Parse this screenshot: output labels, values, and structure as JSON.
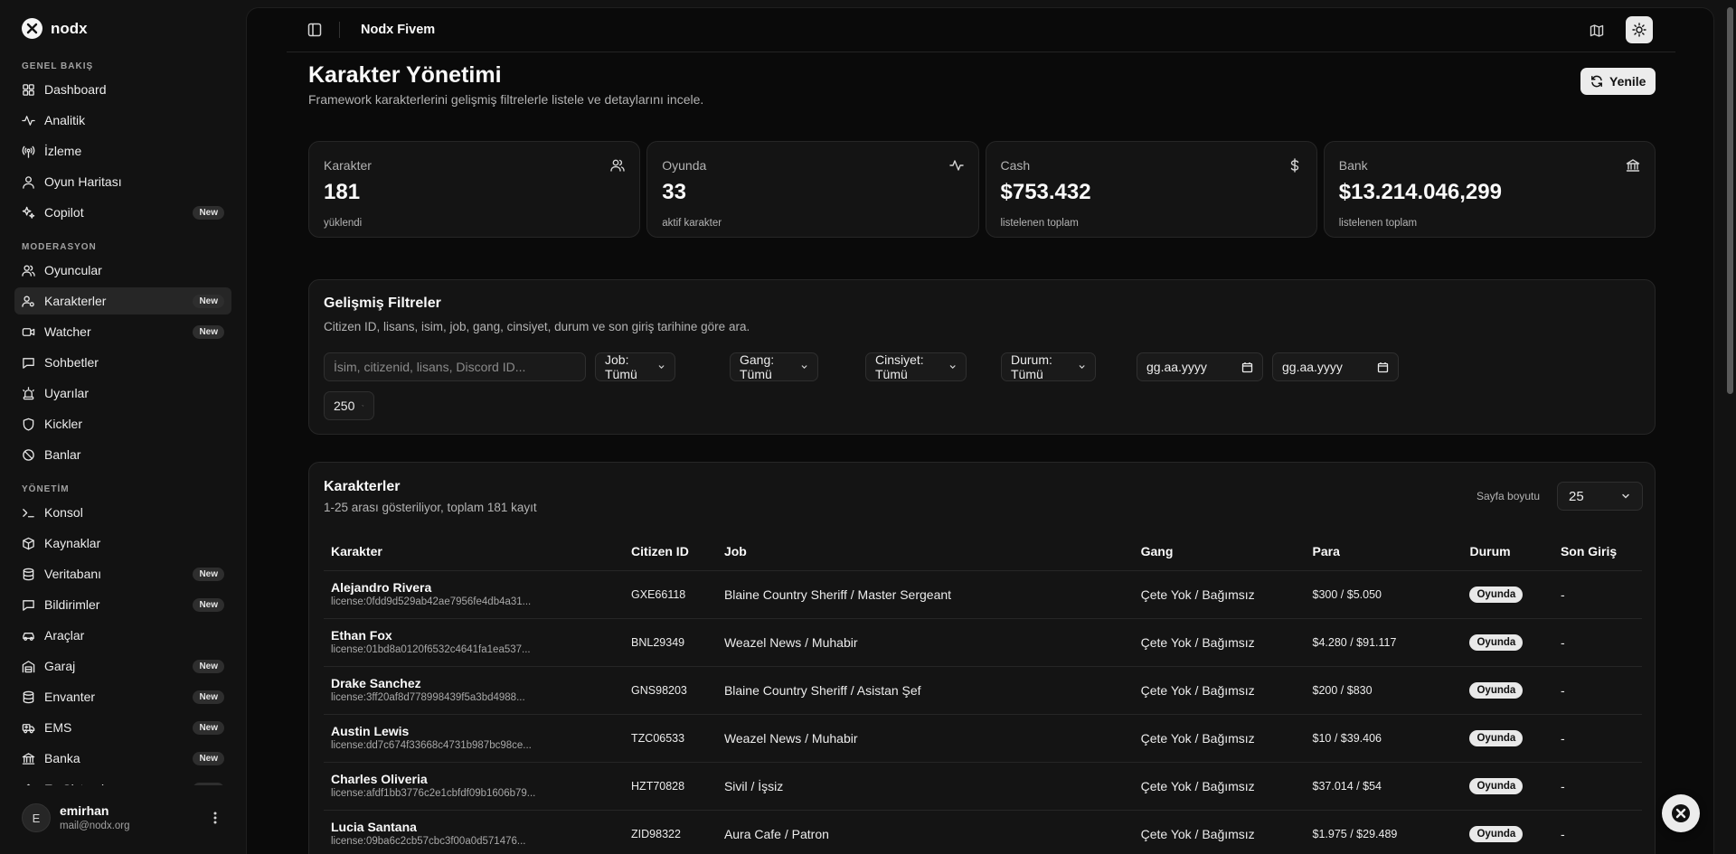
{
  "brand": {
    "name": "nodx"
  },
  "sidebar": {
    "sections": [
      {
        "title": "GENEL BAKIŞ",
        "items": [
          {
            "label": "Dashboard",
            "icon": "dashboard-icon"
          },
          {
            "label": "Analitik",
            "icon": "activity-icon"
          },
          {
            "label": "İzleme",
            "icon": "radio-tower-icon"
          },
          {
            "label": "Oyun Haritası",
            "icon": "user-map-icon"
          },
          {
            "label": "Copilot",
            "icon": "sparkles-icon",
            "badge": "New"
          }
        ]
      },
      {
        "title": "MODERASYON",
        "items": [
          {
            "label": "Oyuncular",
            "icon": "users-icon"
          },
          {
            "label": "Karakterler",
            "icon": "user-cog-icon",
            "badge": "New",
            "active": true
          },
          {
            "label": "Watcher",
            "icon": "video-icon",
            "badge": "New"
          },
          {
            "label": "Sohbetler",
            "icon": "message-icon"
          },
          {
            "label": "Uyarılar",
            "icon": "siren-icon"
          },
          {
            "label": "Kickler",
            "icon": "shield-icon"
          },
          {
            "label": "Banlar",
            "icon": "ban-icon"
          }
        ]
      },
      {
        "title": "YÖNETİM",
        "items": [
          {
            "label": "Konsol",
            "icon": "terminal-icon"
          },
          {
            "label": "Kaynaklar",
            "icon": "package-icon"
          },
          {
            "label": "Veritabanı",
            "icon": "database-icon",
            "badge": "New"
          },
          {
            "label": "Bildirimler",
            "icon": "message-icon",
            "badge": "New"
          },
          {
            "label": "Araçlar",
            "icon": "car-icon"
          },
          {
            "label": "Garaj",
            "icon": "warehouse-icon",
            "badge": "New"
          },
          {
            "label": "Envanter",
            "icon": "database-icon",
            "badge": "New"
          },
          {
            "label": "EMS",
            "icon": "ambulance-icon",
            "badge": "New"
          },
          {
            "label": "Banka",
            "icon": "bank-icon",
            "badge": "New"
          },
          {
            "label": "Ev Sistemi",
            "icon": "home-icon",
            "badge": "New"
          }
        ]
      }
    ]
  },
  "user": {
    "initial": "E",
    "name": "emirhan",
    "email": "mail@nodx.org"
  },
  "topbar": {
    "title": "Nodx Fivem"
  },
  "page": {
    "title": "Karakter Yönetimi",
    "subtitle": "Framework karakterlerini gelişmiş filtrelerle listele ve detaylarını incele.",
    "refresh_label": "Yenile"
  },
  "stats": [
    {
      "label": "Karakter",
      "value": "181",
      "foot": "yüklendi",
      "icon": "users-icon"
    },
    {
      "label": "Oyunda",
      "value": "33",
      "foot": "aktif karakter",
      "icon": "activity-icon"
    },
    {
      "label": "Cash",
      "value": "$753.432",
      "foot": "listelenen toplam",
      "icon": "dollar-icon"
    },
    {
      "label": "Bank",
      "value": "$13.214.046,299",
      "foot": "listelenen toplam",
      "icon": "bank-icon"
    }
  ],
  "filters": {
    "title": "Gelişmiş Filtreler",
    "subtitle": "Citizen ID, lisans, isim, job, gang, cinsiyet, durum ve son giriş tarihine göre ara.",
    "search_placeholder": "İsim, citizenid, lisans, Discord ID...",
    "job": "Job: Tümü",
    "gang": "Gang: Tümü",
    "gender": "Cinsiyet: Tümü",
    "status": "Durum: Tümü",
    "date_from": "gg.aa.yyyy",
    "date_to": "gg.aa.yyyy",
    "limit": "250"
  },
  "table": {
    "title": "Karakterler",
    "subtitle": "1-25 arası gösteriliyor, toplam 181 kayıt",
    "page_size_label": "Sayfa boyutu",
    "page_size": "25",
    "columns": [
      "Karakter",
      "Citizen ID",
      "Job",
      "Gang",
      "Para",
      "Durum",
      "Son Giriş"
    ],
    "rows": [
      {
        "name": "Alejandro Rivera",
        "license": "license:0fdd9d529ab42ae7956fe4db4a31...",
        "cid": "GXE66118",
        "job": "Blaine Country Sheriff / Master Sergeant",
        "gang": "Çete Yok / Bağımsız",
        "para": "$300 / $5.050",
        "status": "Oyunda",
        "last": "-"
      },
      {
        "name": "Ethan Fox",
        "license": "license:01bd8a0120f6532c4641fa1ea537...",
        "cid": "BNL29349",
        "job": "Weazel News / Muhabir",
        "gang": "Çete Yok / Bağımsız",
        "para": "$4.280 / $91.117",
        "status": "Oyunda",
        "last": "-"
      },
      {
        "name": "Drake Sanchez",
        "license": "license:3ff20af8d778998439f5a3bd4988...",
        "cid": "GNS98203",
        "job": "Blaine Country Sheriff / Asistan Şef",
        "gang": "Çete Yok / Bağımsız",
        "para": "$200 / $830",
        "status": "Oyunda",
        "last": "-"
      },
      {
        "name": "Austin Lewis",
        "license": "license:dd7c674f33668c4731b987bc98ce...",
        "cid": "TZC06533",
        "job": "Weazel News / Muhabir",
        "gang": "Çete Yok / Bağımsız",
        "para": "$10 / $39.406",
        "status": "Oyunda",
        "last": "-"
      },
      {
        "name": "Charles Oliveria",
        "license": "license:afdf1bb3776c2e1cbfdf09b1606b79...",
        "cid": "HZT70828",
        "job": "Sivil / İşsiz",
        "gang": "Çete Yok / Bağımsız",
        "para": "$37.014 / $54",
        "status": "Oyunda",
        "last": "-"
      },
      {
        "name": "Lucia Santana",
        "license": "license:09ba6c2cb57cbc3f00a0d571476...",
        "cid": "ZID98322",
        "job": "Aura Cafe / Patron",
        "gang": "Çete Yok / Bağımsız",
        "para": "$1.975 / $29.489",
        "status": "Oyunda",
        "last": "-"
      }
    ]
  }
}
